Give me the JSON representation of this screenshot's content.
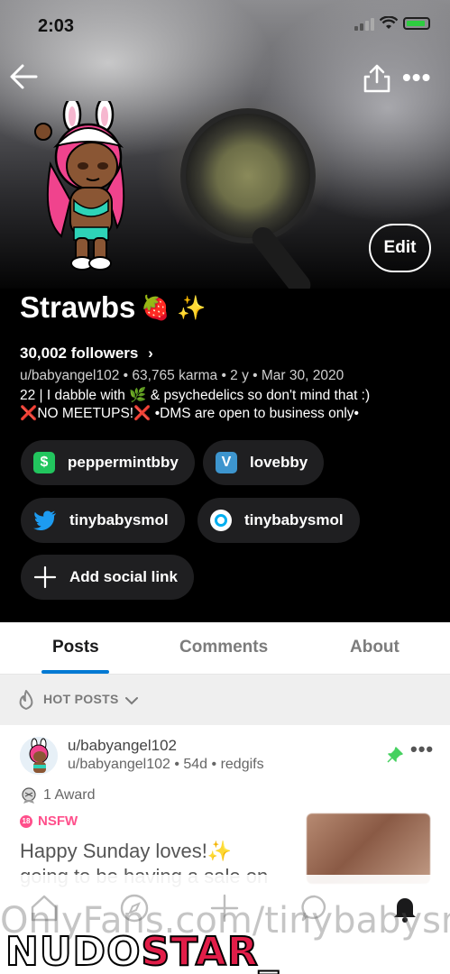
{
  "status_bar": {
    "time": "2:03"
  },
  "profile": {
    "display_name": "Strawbs",
    "name_emoji": "🍓 ✨",
    "followers": "30,002 followers",
    "meta": "u/babyangel102 • 63,765 karma • 2 y • Mar 30, 2020",
    "bio_line1": "22 | I dabble with 🌿 & psychedelics so don't mind that :)",
    "bio_line2_x1": "❌",
    "bio_line2_a": "NO MEETUPS!",
    "bio_line2_x2": "❌",
    "bio_line2_b": " •DMS are open to business only•",
    "edit_label": "Edit"
  },
  "social_links": [
    {
      "label": "peppermintbby",
      "icon": "dollar-icon",
      "color": "#22c55e"
    },
    {
      "label": "lovebby",
      "icon": "venmo-icon",
      "color": "#3d95ce"
    },
    {
      "label": "tinybabysmol",
      "icon": "twitter-icon",
      "color": "#1d9bf0"
    },
    {
      "label": "tinybabysmol",
      "icon": "onlyfans-icon",
      "color": "#00aff0"
    },
    {
      "label": "Add social link",
      "icon": "plus-icon",
      "color": "#ffffff"
    }
  ],
  "tabs": [
    {
      "label": "Posts"
    },
    {
      "label": "Comments"
    },
    {
      "label": "About"
    }
  ],
  "sort": {
    "label": "HOT POSTS"
  },
  "post": {
    "author": "u/babyangel102",
    "sub_line": "u/babyangel102 • 54d • redgifs",
    "award": "1 Award",
    "nsfw": "NSFW",
    "nsfw_badge": "18",
    "title_line1": "Happy Sunday loves!✨",
    "title_line2": "going to be having a sale on"
  },
  "watermark": {
    "url": "OnlyFans.com/tinybabysmo",
    "logo_a": "NUDO",
    "logo_b": "STAR",
    "logo_c": "_"
  },
  "colors": {
    "accent": "#0079d3",
    "nsfw": "#ff4f8b",
    "pin": "#46d160"
  }
}
